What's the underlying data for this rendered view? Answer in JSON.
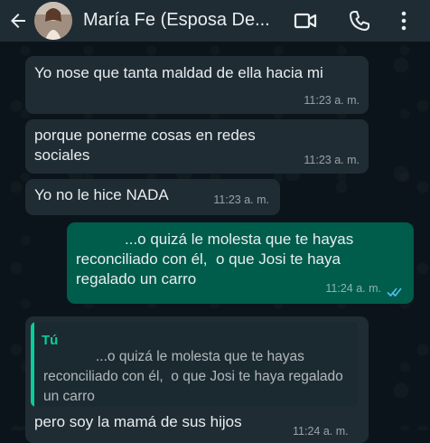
{
  "header": {
    "contact_name": "María Fe (Esposa De...",
    "icons": [
      "back-arrow-icon",
      "video-call-icon",
      "phone-icon",
      "more-vert-icon"
    ]
  },
  "messages": [
    {
      "direction": "in",
      "text": "Yo nose que tanta maldad de ella hacia mi",
      "time": "11:23 a. m."
    },
    {
      "direction": "in",
      "text": "porque ponerme cosas en redes sociales",
      "time": "11:23 a. m."
    },
    {
      "direction": "in",
      "text": "Yo no le hice NADA",
      "time": "11:23 a. m."
    },
    {
      "direction": "out",
      "text": "...o quizá le molesta que te hayas reconciliado con él,  o que Josi te haya regalado un carro",
      "time": "11:24 a. m.",
      "status": "read"
    },
    {
      "direction": "in",
      "quote": {
        "author": "Tú",
        "text": "...o quizá le molesta que te hayas reconciliado con él,  o que Josi te haya regalado un carro"
      },
      "text": "pero soy la mamá de sus hijos",
      "time": "11:24 a. m."
    }
  ],
  "colors": {
    "header_bg": "#1f2c34",
    "chat_bg": "#0b141a",
    "incoming_bubble": "#1f2c34",
    "outgoing_bubble": "#005c4b",
    "accent": "#06cf9c",
    "read_ticks": "#53bdeb"
  }
}
